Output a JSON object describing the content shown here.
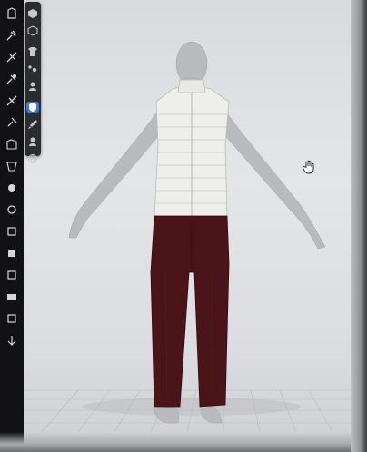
{
  "app": {
    "type": "3D garment simulation viewport"
  },
  "toolbar": {
    "items": [
      {
        "icon": "garment-icon"
      },
      {
        "icon": "pin-icon"
      },
      {
        "icon": "fold-icon"
      },
      {
        "icon": "pin-icon"
      },
      {
        "icon": "sew-icon"
      },
      {
        "icon": "pin-icon"
      },
      {
        "icon": "pattern-icon"
      },
      {
        "icon": "pattern-icon"
      },
      {
        "icon": "circle-icon"
      },
      {
        "icon": "circle-icon"
      },
      {
        "icon": "square-icon"
      },
      {
        "icon": "square-icon"
      },
      {
        "icon": "square-icon"
      },
      {
        "icon": "square-icon"
      },
      {
        "icon": "square-icon"
      },
      {
        "icon": "arrow-icon"
      }
    ]
  },
  "view_panel": {
    "buttons": [
      {
        "icon": "cube-icon",
        "active": false
      },
      {
        "icon": "cube-icon",
        "active": false
      },
      {
        "icon": "shirt-icon",
        "active": false
      },
      {
        "icon": "dots-icon",
        "active": false
      },
      {
        "icon": "avatar-icon",
        "active": false
      },
      {
        "icon": "shield-icon",
        "active": true
      },
      {
        "icon": "brush-icon",
        "active": false
      },
      {
        "icon": "avatar-icon",
        "active": false
      },
      {
        "icon": "globe-icon",
        "active": false
      }
    ]
  },
  "scene": {
    "vest_color": "#eeeeea",
    "pants_color": "#4b1418",
    "avatar_color": "#b9babd",
    "floor_grid": true
  },
  "colors": {
    "background": "#dcdde0",
    "toolbar": "#121214",
    "accent": "#3a78d8"
  }
}
